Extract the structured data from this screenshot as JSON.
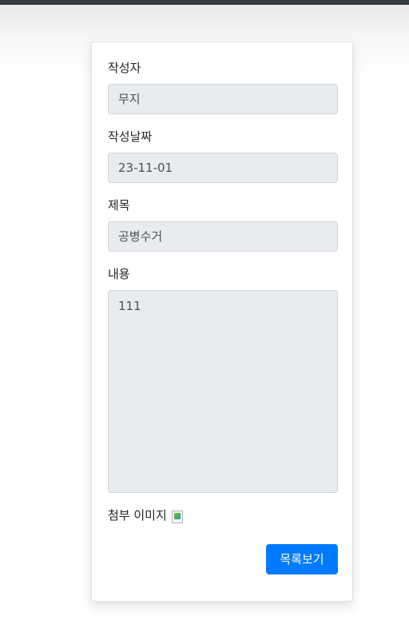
{
  "form": {
    "author_label": "작성자",
    "author_value": "무지",
    "date_label": "작성날짜",
    "date_value": "23-11-01",
    "title_label": "제목",
    "title_value": "공병수거",
    "content_label": "내용",
    "content_value": "111",
    "attachment_label": "첨부 이미지"
  },
  "actions": {
    "list_button_label": "목록보기"
  },
  "colors": {
    "primary": "#007bff",
    "readonly_bg": "#e9ecef",
    "topbar": "#343a40"
  }
}
